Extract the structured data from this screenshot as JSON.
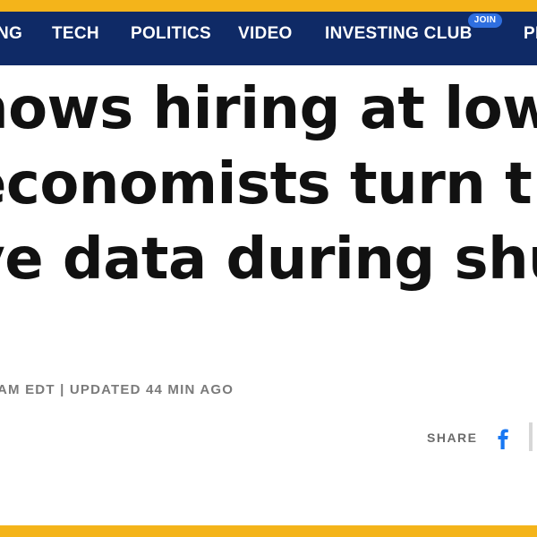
{
  "colors": {
    "accent_strip": "#f4b41a",
    "navbar_bg": "#0f2a66",
    "join_badge": "#2f6fe0",
    "facebook_blue": "#1877f2"
  },
  "nav": {
    "items": [
      {
        "label": "NG"
      },
      {
        "label": "TECH"
      },
      {
        "label": "POLITICS"
      },
      {
        "label": "VIDEO"
      },
      {
        "label": "INVESTING CLUB"
      },
      {
        "label": "PI"
      }
    ],
    "join_badge": "JOIN"
  },
  "article": {
    "headline_lines": [
      "hows hiring at low",
      "economists turn t",
      "ve data during shu"
    ],
    "byline": "AM EDT | UPDATED 44 MIN AGO"
  },
  "share": {
    "label": "SHARE",
    "icons": [
      "facebook-icon",
      "next-share-icon"
    ]
  }
}
